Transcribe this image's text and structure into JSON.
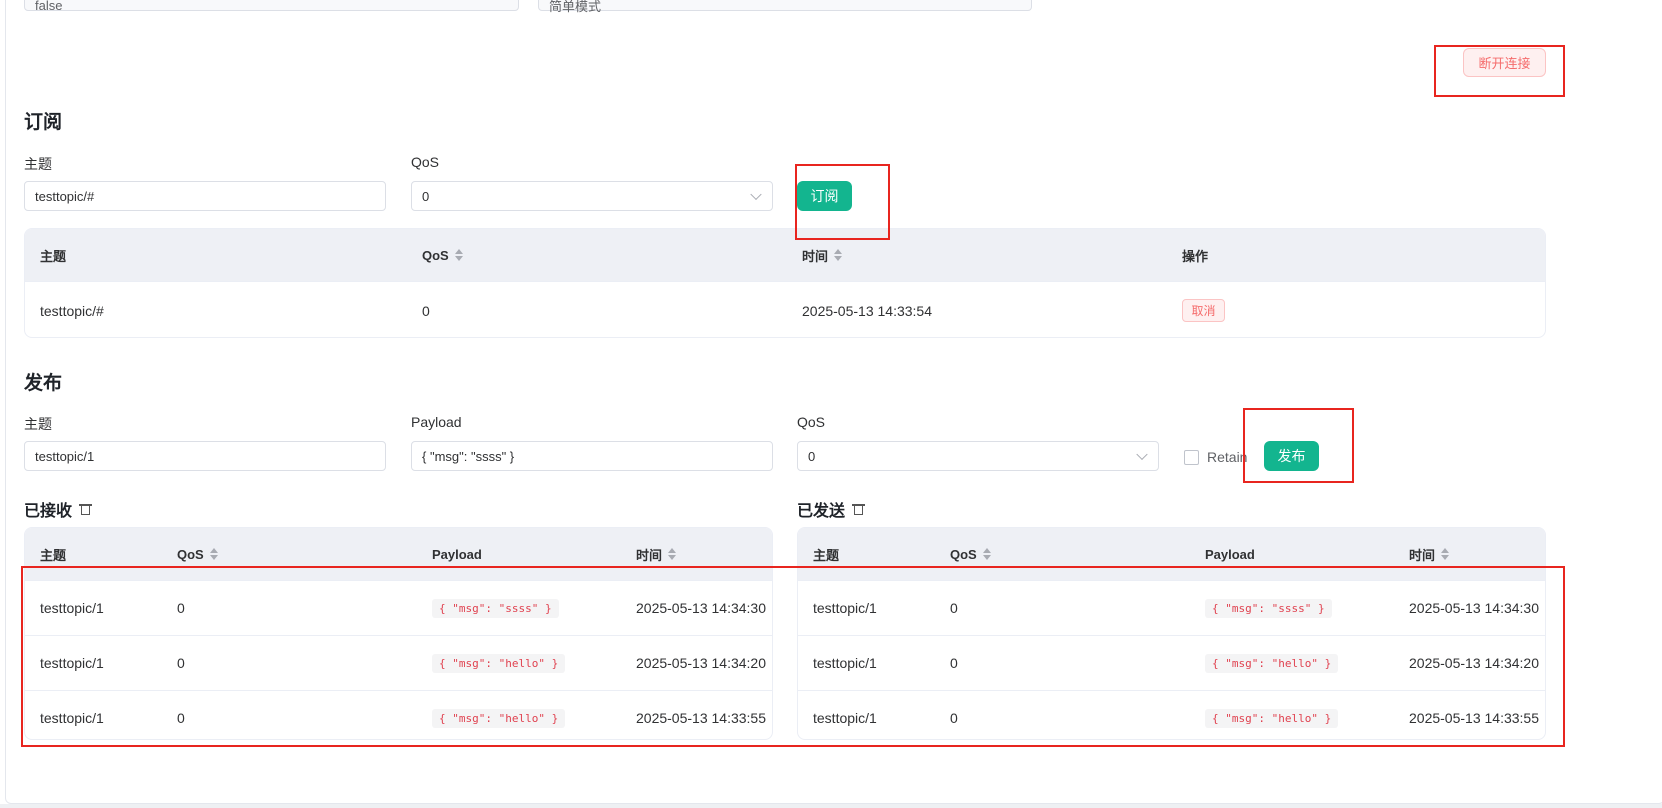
{
  "connection": {
    "top_field_left_value": "false",
    "top_field_right_value": "简单模式",
    "disconnect_label": "断开连接"
  },
  "subscribe": {
    "title": "订阅",
    "topic_label": "主题",
    "topic_value": "testtopic/#",
    "qos_label": "QoS",
    "qos_value": "0",
    "button_label": "订阅",
    "table": {
      "headers": [
        "主题",
        "QoS",
        "时间",
        "操作"
      ],
      "rows": [
        {
          "topic": "testtopic/#",
          "qos": "0",
          "time": "2025-05-13 14:33:54",
          "action": "取消"
        }
      ]
    }
  },
  "publish": {
    "title": "发布",
    "topic_label": "主题",
    "topic_value": "testtopic/1",
    "payload_label": "Payload",
    "payload_value": "{ \"msg\": \"ssss\" }",
    "qos_label": "QoS",
    "qos_value": "0",
    "retain_label": "Retain",
    "button_label": "发布"
  },
  "received": {
    "title": "已接收",
    "headers": [
      "主题",
      "QoS",
      "Payload",
      "时间"
    ],
    "rows": [
      {
        "topic": "testtopic/1",
        "qos": "0",
        "payload": "{ \"msg\": \"ssss\" }",
        "time": "2025-05-13 14:34:30"
      },
      {
        "topic": "testtopic/1",
        "qos": "0",
        "payload": "{ \"msg\": \"hello\" }",
        "time": "2025-05-13 14:34:20"
      },
      {
        "topic": "testtopic/1",
        "qos": "0",
        "payload": "{ \"msg\": \"hello\" }",
        "time": "2025-05-13 14:33:55"
      }
    ]
  },
  "sent": {
    "title": "已发送",
    "headers": [
      "主题",
      "QoS",
      "Payload",
      "时间"
    ],
    "rows": [
      {
        "topic": "testtopic/1",
        "qos": "0",
        "payload": "{ \"msg\": \"ssss\" }",
        "time": "2025-05-13 14:34:30"
      },
      {
        "topic": "testtopic/1",
        "qos": "0",
        "payload": "{ \"msg\": \"hello\" }",
        "time": "2025-05-13 14:34:20"
      },
      {
        "topic": "testtopic/1",
        "qos": "0",
        "payload": "{ \"msg\": \"hello\" }",
        "time": "2025-05-13 14:33:55"
      }
    ]
  },
  "colors": {
    "primary": "#13b58f",
    "danger": "#f56c6c",
    "annotation": "#e8251f",
    "table_header_bg": "#eef0f5"
  }
}
